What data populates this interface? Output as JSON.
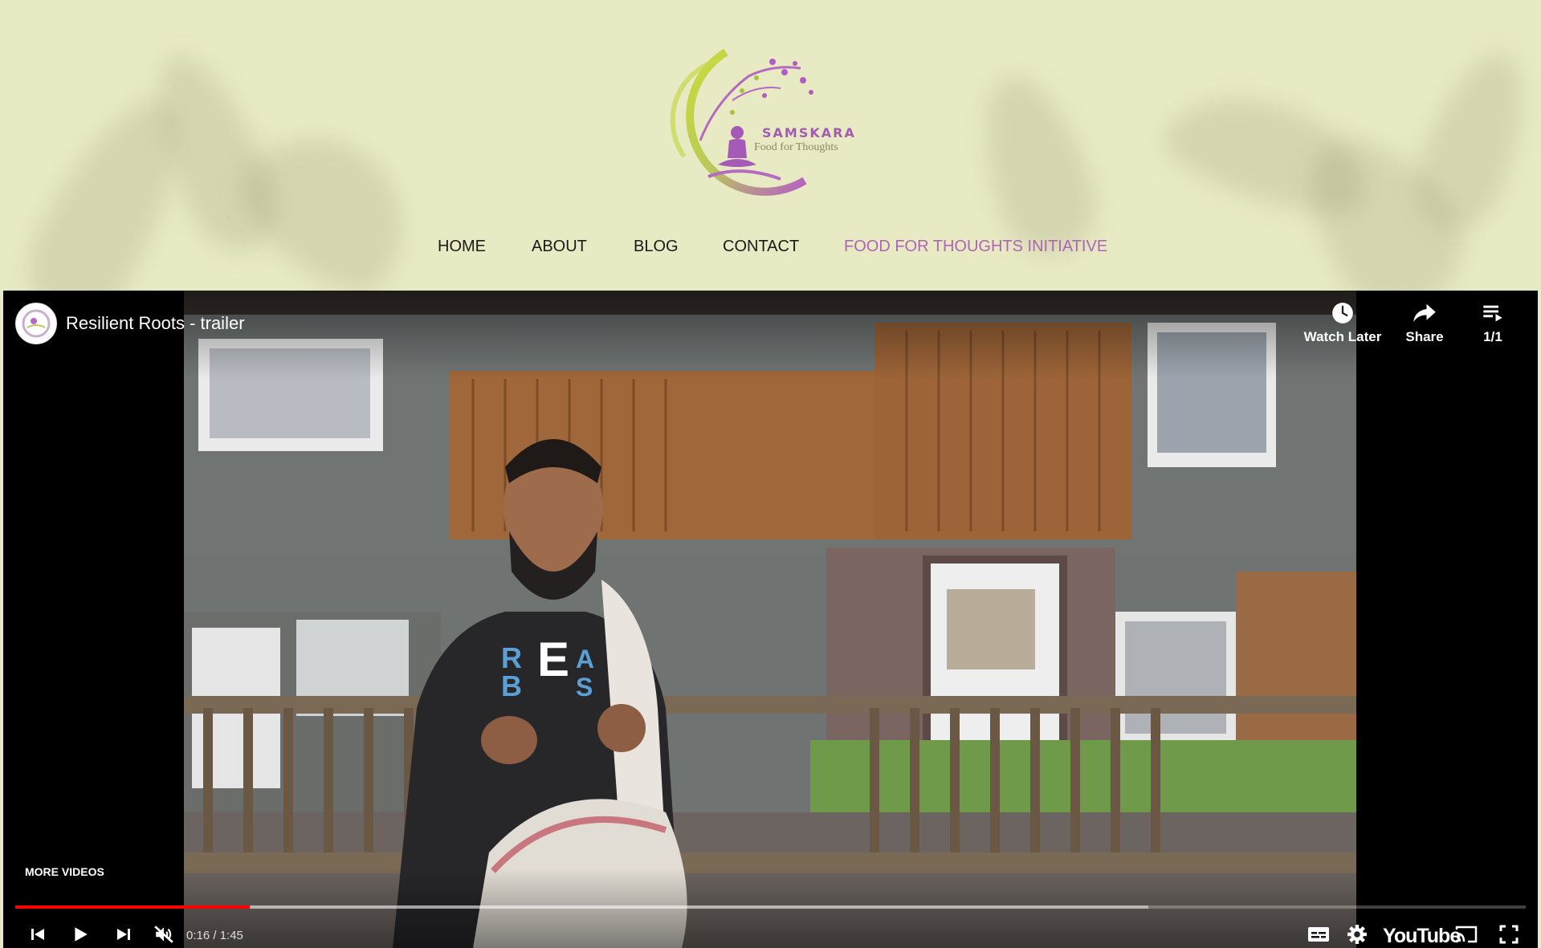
{
  "brand": {
    "name": "SAMSKARA",
    "tagline": "Food for Thoughts"
  },
  "nav": {
    "items": [
      {
        "label": "HOME",
        "active": false
      },
      {
        "label": "ABOUT",
        "active": false
      },
      {
        "label": "BLOG",
        "active": false
      },
      {
        "label": "CONTACT",
        "active": false
      },
      {
        "label": "FOOD FOR THOUGHTS INITIATIVE",
        "active": true
      }
    ]
  },
  "player": {
    "title": "Resilient Roots - trailer",
    "watch_later_label": "Watch Later",
    "share_label": "Share",
    "playlist_count": "1/1",
    "more_videos_label": "MORE VIDEOS",
    "time_display": "0:16 / 1:45",
    "progress_played_fraction": 0.155,
    "progress_loaded_fraction": 0.75,
    "youtube_label": "YouTube",
    "muted": true,
    "icons": [
      "clock-icon",
      "share-arrow-icon",
      "playlist-icon",
      "previous-icon",
      "play-icon",
      "next-icon",
      "muted-volume-icon",
      "captions-icon",
      "gear-icon",
      "cast-icon",
      "fullscreen-icon"
    ]
  },
  "colors": {
    "header_bg": "#e8eac4",
    "nav_active": "#ae65b6",
    "progress_red": "#ff0000",
    "brand_purple": "#a25cb0"
  }
}
